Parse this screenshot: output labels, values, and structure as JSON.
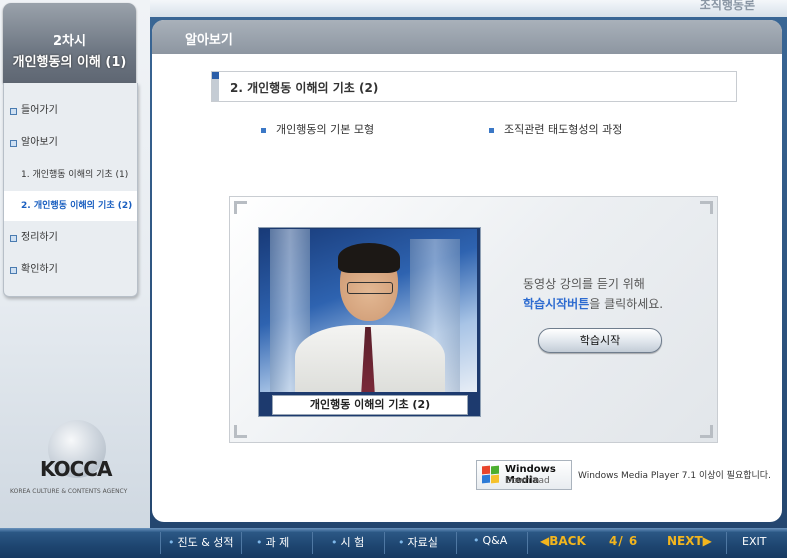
{
  "header": {
    "top_right": "조직행동론"
  },
  "sidebar": {
    "lesson_number": "2차시",
    "lesson_title": "개인행동의 이해 (1)",
    "items": [
      {
        "label": "들어가기"
      },
      {
        "label": "알아보기"
      },
      {
        "label": "1. 개인행동 이해의 기초 (1)"
      },
      {
        "label": "2. 개인행동 이해의 기초 (2)"
      },
      {
        "label": "정리하기"
      },
      {
        "label": "확인하기"
      }
    ],
    "logo_text": "KOCCA",
    "logo_sub": "KOREA CULTURE & CONTENTS AGENCY"
  },
  "main": {
    "section_header": "알아보기",
    "section_title": "2. 개인행동 이해의 기초 (2)",
    "topics": [
      "개인행동의 기본 모형",
      "조직관련 태도형성의 과정"
    ],
    "video_caption": "개인행동 이해의 기초 (2)",
    "message_line1": "동영상 강의를 듣기 위해",
    "message_highlight": "학습시작버튼",
    "message_line2_rest": "을 클릭하세요.",
    "start_button": "학습시작",
    "wmp_badge_title": "Windows Media",
    "wmp_badge_sub": "Download",
    "wmp_note": "Windows Media Player 7.1 이상이 필요합니다."
  },
  "bottom_nav": {
    "items": [
      "진도 & 성적",
      "과 제",
      "시 험",
      "자료실",
      "Q&A"
    ],
    "back": "◀BACK",
    "page": "4/ 6",
    "next": "NEXT▶",
    "exit": "EXIT"
  }
}
